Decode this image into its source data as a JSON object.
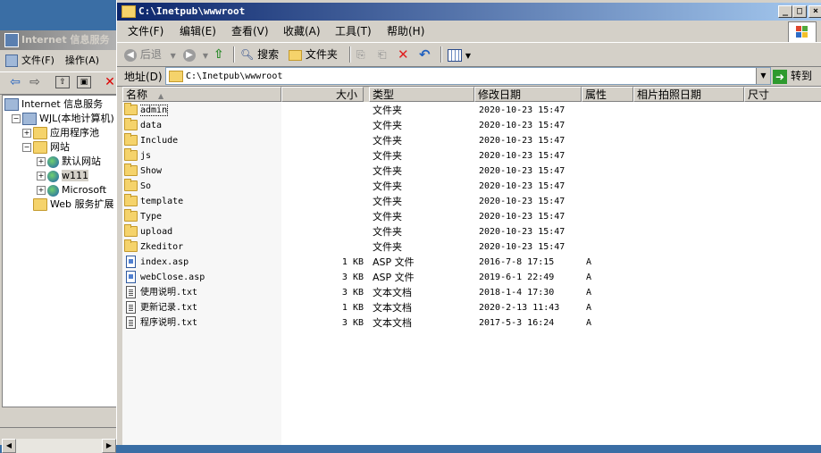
{
  "iis": {
    "title": "Internet 信息服务",
    "menu": [
      "文件(F)",
      "操作(A)"
    ],
    "tree": [
      {
        "label": "Internet 信息服务",
        "icon": "pc-icon",
        "level": 0,
        "expander": ""
      },
      {
        "label": "WJL(本地计算机)",
        "icon": "computer-icon",
        "level": 1,
        "expander": "−"
      },
      {
        "label": "应用程序池",
        "icon": "folder-icon",
        "level": 2,
        "expander": "+"
      },
      {
        "label": "网站",
        "icon": "folder-icon",
        "level": 2,
        "expander": "−"
      },
      {
        "label": "默认网站",
        "icon": "globe-icon",
        "level": 3,
        "expander": "+"
      },
      {
        "label": "w111",
        "icon": "globe-icon",
        "level": 3,
        "expander": "+",
        "selected": true
      },
      {
        "label": "Microsoft",
        "icon": "globe-icon",
        "level": 3,
        "expander": "+"
      },
      {
        "label": "Web 服务扩展",
        "icon": "folder-icon",
        "level": 2,
        "expander": ""
      }
    ]
  },
  "explorer": {
    "title": "C:\\Inetpub\\wwwroot",
    "menu": [
      "文件(F)",
      "编辑(E)",
      "查看(V)",
      "收藏(A)",
      "工具(T)",
      "帮助(H)"
    ],
    "toolbar": {
      "back": "后退",
      "search": "搜索",
      "folders": "文件夹"
    },
    "address": {
      "label": "地址(D)",
      "value": "C:\\Inetpub\\wwwroot",
      "go": "转到"
    },
    "columns": [
      "名称",
      "大小",
      "类型",
      "修改日期",
      "属性",
      "相片拍照日期",
      "尺寸"
    ],
    "files": [
      {
        "name": "admin",
        "size": "",
        "type": "文件夹",
        "date": "2020-10-23 15:47",
        "attr": "",
        "icon": "folder"
      },
      {
        "name": "data",
        "size": "",
        "type": "文件夹",
        "date": "2020-10-23 15:47",
        "attr": "",
        "icon": "folder"
      },
      {
        "name": "Include",
        "size": "",
        "type": "文件夹",
        "date": "2020-10-23 15:47",
        "attr": "",
        "icon": "folder"
      },
      {
        "name": "js",
        "size": "",
        "type": "文件夹",
        "date": "2020-10-23 15:47",
        "attr": "",
        "icon": "folder"
      },
      {
        "name": "Show",
        "size": "",
        "type": "文件夹",
        "date": "2020-10-23 15:47",
        "attr": "",
        "icon": "folder"
      },
      {
        "name": "So",
        "size": "",
        "type": "文件夹",
        "date": "2020-10-23 15:47",
        "attr": "",
        "icon": "folder"
      },
      {
        "name": "template",
        "size": "",
        "type": "文件夹",
        "date": "2020-10-23 15:47",
        "attr": "",
        "icon": "folder"
      },
      {
        "name": "Type",
        "size": "",
        "type": "文件夹",
        "date": "2020-10-23 15:47",
        "attr": "",
        "icon": "folder"
      },
      {
        "name": "upload",
        "size": "",
        "type": "文件夹",
        "date": "2020-10-23 15:47",
        "attr": "",
        "icon": "folder"
      },
      {
        "name": "Zkeditor",
        "size": "",
        "type": "文件夹",
        "date": "2020-10-23 15:47",
        "attr": "",
        "icon": "folder"
      },
      {
        "name": "index.asp",
        "size": "1 KB",
        "type": "ASP 文件",
        "date": "2016-7-8 17:15",
        "attr": "A",
        "icon": "asp"
      },
      {
        "name": "webClose.asp",
        "size": "3 KB",
        "type": "ASP 文件",
        "date": "2019-6-1 22:49",
        "attr": "A",
        "icon": "asp"
      },
      {
        "name": "使用说明.txt",
        "size": "3 KB",
        "type": "文本文档",
        "date": "2018-1-4 17:30",
        "attr": "A",
        "icon": "txt"
      },
      {
        "name": "更新记录.txt",
        "size": "1 KB",
        "type": "文本文档",
        "date": "2020-2-13 11:43",
        "attr": "A",
        "icon": "txt"
      },
      {
        "name": "程序说明.txt",
        "size": "3 KB",
        "type": "文本文档",
        "date": "2017-5-3 16:24",
        "attr": "A",
        "icon": "txt"
      }
    ]
  },
  "colors": {
    "titlebar_active": "#0a246a",
    "titlebar_inactive": "#808080",
    "chrome": "#d4d0c8",
    "desktop": "#3a6ea5"
  }
}
